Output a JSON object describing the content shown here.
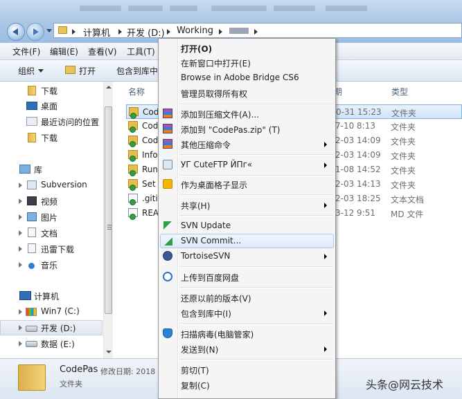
{
  "address": {
    "crumbs": [
      "计算机",
      "开发 (D:)",
      "Working"
    ]
  },
  "menubar": [
    "文件(F)",
    "编辑(E)",
    "查看(V)",
    "工具(T)"
  ],
  "toolbar": {
    "organize": "组织",
    "open": "打开",
    "include_library": "包含到库中"
  },
  "nav": {
    "favorites": [
      "下载",
      "桌面",
      "最近访问的位置",
      "下载"
    ],
    "library": {
      "title": "库",
      "items": [
        "Subversion",
        "视频",
        "图片",
        "文档",
        "迅雷下载",
        "音乐"
      ]
    },
    "computer": {
      "title": "计算机",
      "drives": [
        "Win7 (C:)",
        "开发 (D:)",
        "数据 (E:)"
      ]
    }
  },
  "filelist": {
    "columns": {
      "name": "名称",
      "date_partial": "期",
      "type": "类型"
    },
    "rows": [
      {
        "name": "Code",
        "date": "0-31 15:23",
        "type": "文件夹",
        "selected": true
      },
      {
        "name": "Cod",
        "date": "7-10 8:13",
        "type": "文件夹"
      },
      {
        "name": "Cod",
        "date": "2-03 14:09",
        "type": "文件夹"
      },
      {
        "name": "Info",
        "date": "2-03 14:09",
        "type": "文件夹"
      },
      {
        "name": "Run",
        "date": "1-08 14:52",
        "type": "文件夹"
      },
      {
        "name": "Set",
        "date": "2-03 14:13",
        "type": "文件夹"
      },
      {
        "name": ".giti",
        "date": "2-03 18:25",
        "type": "文本文档"
      },
      {
        "name": "REA",
        "date": "3-12 9:51",
        "type": "MD 文件"
      }
    ]
  },
  "details": {
    "name": "CodePas",
    "meta": "修改日期: 2018",
    "type": "文件夹"
  },
  "watermark": "头条@网云技术",
  "context_menu": {
    "open": "打开(O)",
    "open_new_window": "在新窗口中打开(E)",
    "browse_bridge": "Browse in Adobe Bridge CS6",
    "take_ownership": "管理员取得所有权",
    "add_archive": "添加到压缩文件(A)...",
    "add_zip": "添加到 \"CodePas.zip\" (T)",
    "other_compress": "其他压缩命令",
    "cuteftp": "УГ CuteFTP ЙПг«",
    "desktop_grid": "作为桌面格子显示",
    "share": "共享(H)",
    "svn_update": "SVN Update",
    "svn_commit": "SVN Commit...",
    "tortoise": "TortoiseSVN",
    "baidu": "上传到百度网盘",
    "restore": "还原以前的版本(V)",
    "include_lib": "包含到库中(I)",
    "scan_virus": "扫描病毒(电脑管家)",
    "send_to": "发送到(N)",
    "cut": "剪切(T)",
    "copy": "复制(C)"
  }
}
